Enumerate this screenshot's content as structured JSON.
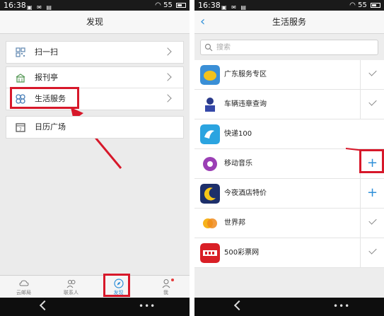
{
  "left": {
    "status": {
      "time": "16:38",
      "battery": "55"
    },
    "title": "发现",
    "menu_groups": [
      [
        {
          "label": "扫一扫",
          "icon": "qr-scan-icon"
        }
      ],
      [
        {
          "label": "报刊亭",
          "icon": "newsstand-icon"
        },
        {
          "label": "生活服务",
          "icon": "life-service-icon"
        }
      ],
      [
        {
          "label": "日历广场",
          "icon": "calendar-icon"
        }
      ]
    ],
    "tabs": [
      {
        "label": "云邮局",
        "icon": "cloud-mail-icon"
      },
      {
        "label": "联系人",
        "icon": "contacts-icon"
      },
      {
        "label": "发现",
        "icon": "compass-icon",
        "active": true
      },
      {
        "label": "我",
        "icon": "user-icon"
      }
    ]
  },
  "right": {
    "status": {
      "time": "16:38",
      "battery": "55"
    },
    "title": "生活服务",
    "search": {
      "placeholder": "搜索",
      "value": ""
    },
    "services": [
      {
        "name": "广东服务专区",
        "action": "added"
      },
      {
        "name": "车辆违章查询",
        "action": "added"
      },
      {
        "name": "快递100",
        "action": "none"
      },
      {
        "name": "移动音乐",
        "action": "add"
      },
      {
        "name": "今夜酒店特价",
        "action": "add"
      },
      {
        "name": "世界邦",
        "action": "added"
      },
      {
        "name": "500彩票网",
        "action": "added"
      }
    ]
  },
  "colors": {
    "accent": "#2e8fd8",
    "highlight": "#d7182a"
  }
}
